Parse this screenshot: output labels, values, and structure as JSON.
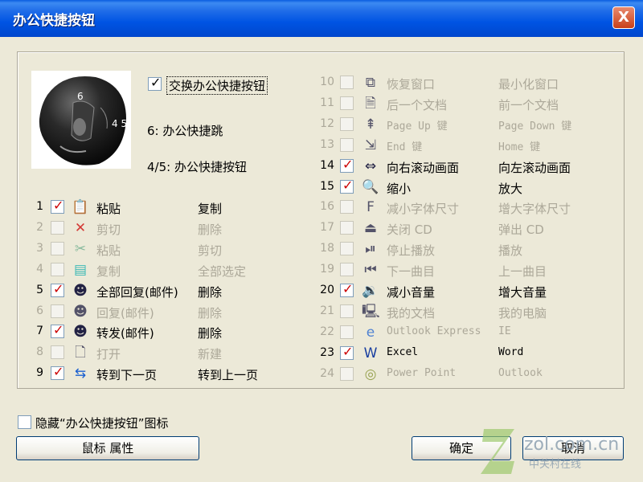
{
  "window": {
    "title": "办公快捷按钮",
    "close_label": "X"
  },
  "mouse_image": {
    "label_6": "6",
    "label_45": "4 5"
  },
  "toggle": {
    "label": "交换办公快捷按钮",
    "checked": true
  },
  "assignments": {
    "btn6": "6: 办公快捷跳",
    "btn45": "4/5: 办公快捷按钮"
  },
  "left_rows": [
    {
      "num": "1",
      "checked": true,
      "enabled": true,
      "icon": "paste-icon",
      "a": "粘贴",
      "b": "复制"
    },
    {
      "num": "2",
      "checked": false,
      "enabled": false,
      "icon": "cut-x-icon",
      "a": "剪切",
      "b": "删除"
    },
    {
      "num": "3",
      "checked": false,
      "enabled": false,
      "icon": "scissors-icon",
      "a": "粘贴",
      "b": "剪切"
    },
    {
      "num": "4",
      "checked": false,
      "enabled": false,
      "icon": "select-all-icon",
      "a": "复制",
      "b": "全部选定"
    },
    {
      "num": "5",
      "checked": true,
      "enabled": true,
      "icon": "reply-all-icon",
      "a": "全部回复(邮件)",
      "b": "删除"
    },
    {
      "num": "6",
      "checked": false,
      "enabled": false,
      "icon": "reply-icon",
      "a": "回复(邮件)",
      "b": "删除"
    },
    {
      "num": "7",
      "checked": true,
      "enabled": true,
      "icon": "forward-icon",
      "a": "转发(邮件)",
      "b": "删除"
    },
    {
      "num": "8",
      "checked": false,
      "enabled": false,
      "icon": "open-file-icon",
      "a": "打开",
      "b": "新建"
    },
    {
      "num": "9",
      "checked": true,
      "enabled": true,
      "icon": "next-page-icon",
      "a": "转到下一页",
      "b": "转到上一页"
    }
  ],
  "right_rows": [
    {
      "num": "10",
      "checked": false,
      "enabled": false,
      "icon": "restore-window-icon",
      "a": "恢复窗口",
      "b": "最小化窗口"
    },
    {
      "num": "11",
      "checked": false,
      "enabled": false,
      "icon": "next-doc-icon",
      "a": "后一个文档",
      "b": "前一个文档"
    },
    {
      "num": "12",
      "checked": false,
      "enabled": false,
      "icon": "page-up-icon",
      "a": "Page Up 键",
      "b": "Page Down 键"
    },
    {
      "num": "13",
      "checked": false,
      "enabled": false,
      "icon": "end-key-icon",
      "a": "End 键",
      "b": "Home 键"
    },
    {
      "num": "14",
      "checked": true,
      "enabled": true,
      "icon": "scroll-right-icon",
      "a": "向右滚动画面",
      "b": "向左滚动画面"
    },
    {
      "num": "15",
      "checked": true,
      "enabled": true,
      "icon": "zoom-icon",
      "a": "缩小",
      "b": "放大"
    },
    {
      "num": "16",
      "checked": false,
      "enabled": false,
      "icon": "font-size-icon",
      "a": "减小字体尺寸",
      "b": "增大字体尺寸"
    },
    {
      "num": "17",
      "checked": false,
      "enabled": false,
      "icon": "eject-icon",
      "a": "关闭 CD",
      "b": "弹出 CD"
    },
    {
      "num": "18",
      "checked": false,
      "enabled": false,
      "icon": "play-pause-icon",
      "a": "停止播放",
      "b": "播放"
    },
    {
      "num": "19",
      "checked": false,
      "enabled": false,
      "icon": "previous-track-icon",
      "a": "下一曲目",
      "b": "上一曲目"
    },
    {
      "num": "20",
      "checked": true,
      "enabled": true,
      "icon": "volume-icon",
      "a": "减小音量",
      "b": "增大音量"
    },
    {
      "num": "21",
      "checked": false,
      "enabled": false,
      "icon": "my-computer-icon",
      "a": "我的文档",
      "b": "我的电脑"
    },
    {
      "num": "22",
      "checked": false,
      "enabled": false,
      "icon": "ie-icon",
      "a": "Outlook Express",
      "b": "IE"
    },
    {
      "num": "23",
      "checked": true,
      "enabled": true,
      "icon": "word-icon",
      "a": "Excel",
      "b": "Word"
    },
    {
      "num": "24",
      "checked": false,
      "enabled": false,
      "icon": "powerpoint-icon",
      "a": "Power Point",
      "b": "Outlook"
    }
  ],
  "hide_icon": {
    "label": "隐藏“办公快捷按钮”图标",
    "checked": false
  },
  "buttons": {
    "mouse_props": "鼠标 属性",
    "ok": "确定",
    "cancel": "取消"
  },
  "watermark": {
    "text": "zol.com.cn",
    "subtext": "中关村在线"
  }
}
